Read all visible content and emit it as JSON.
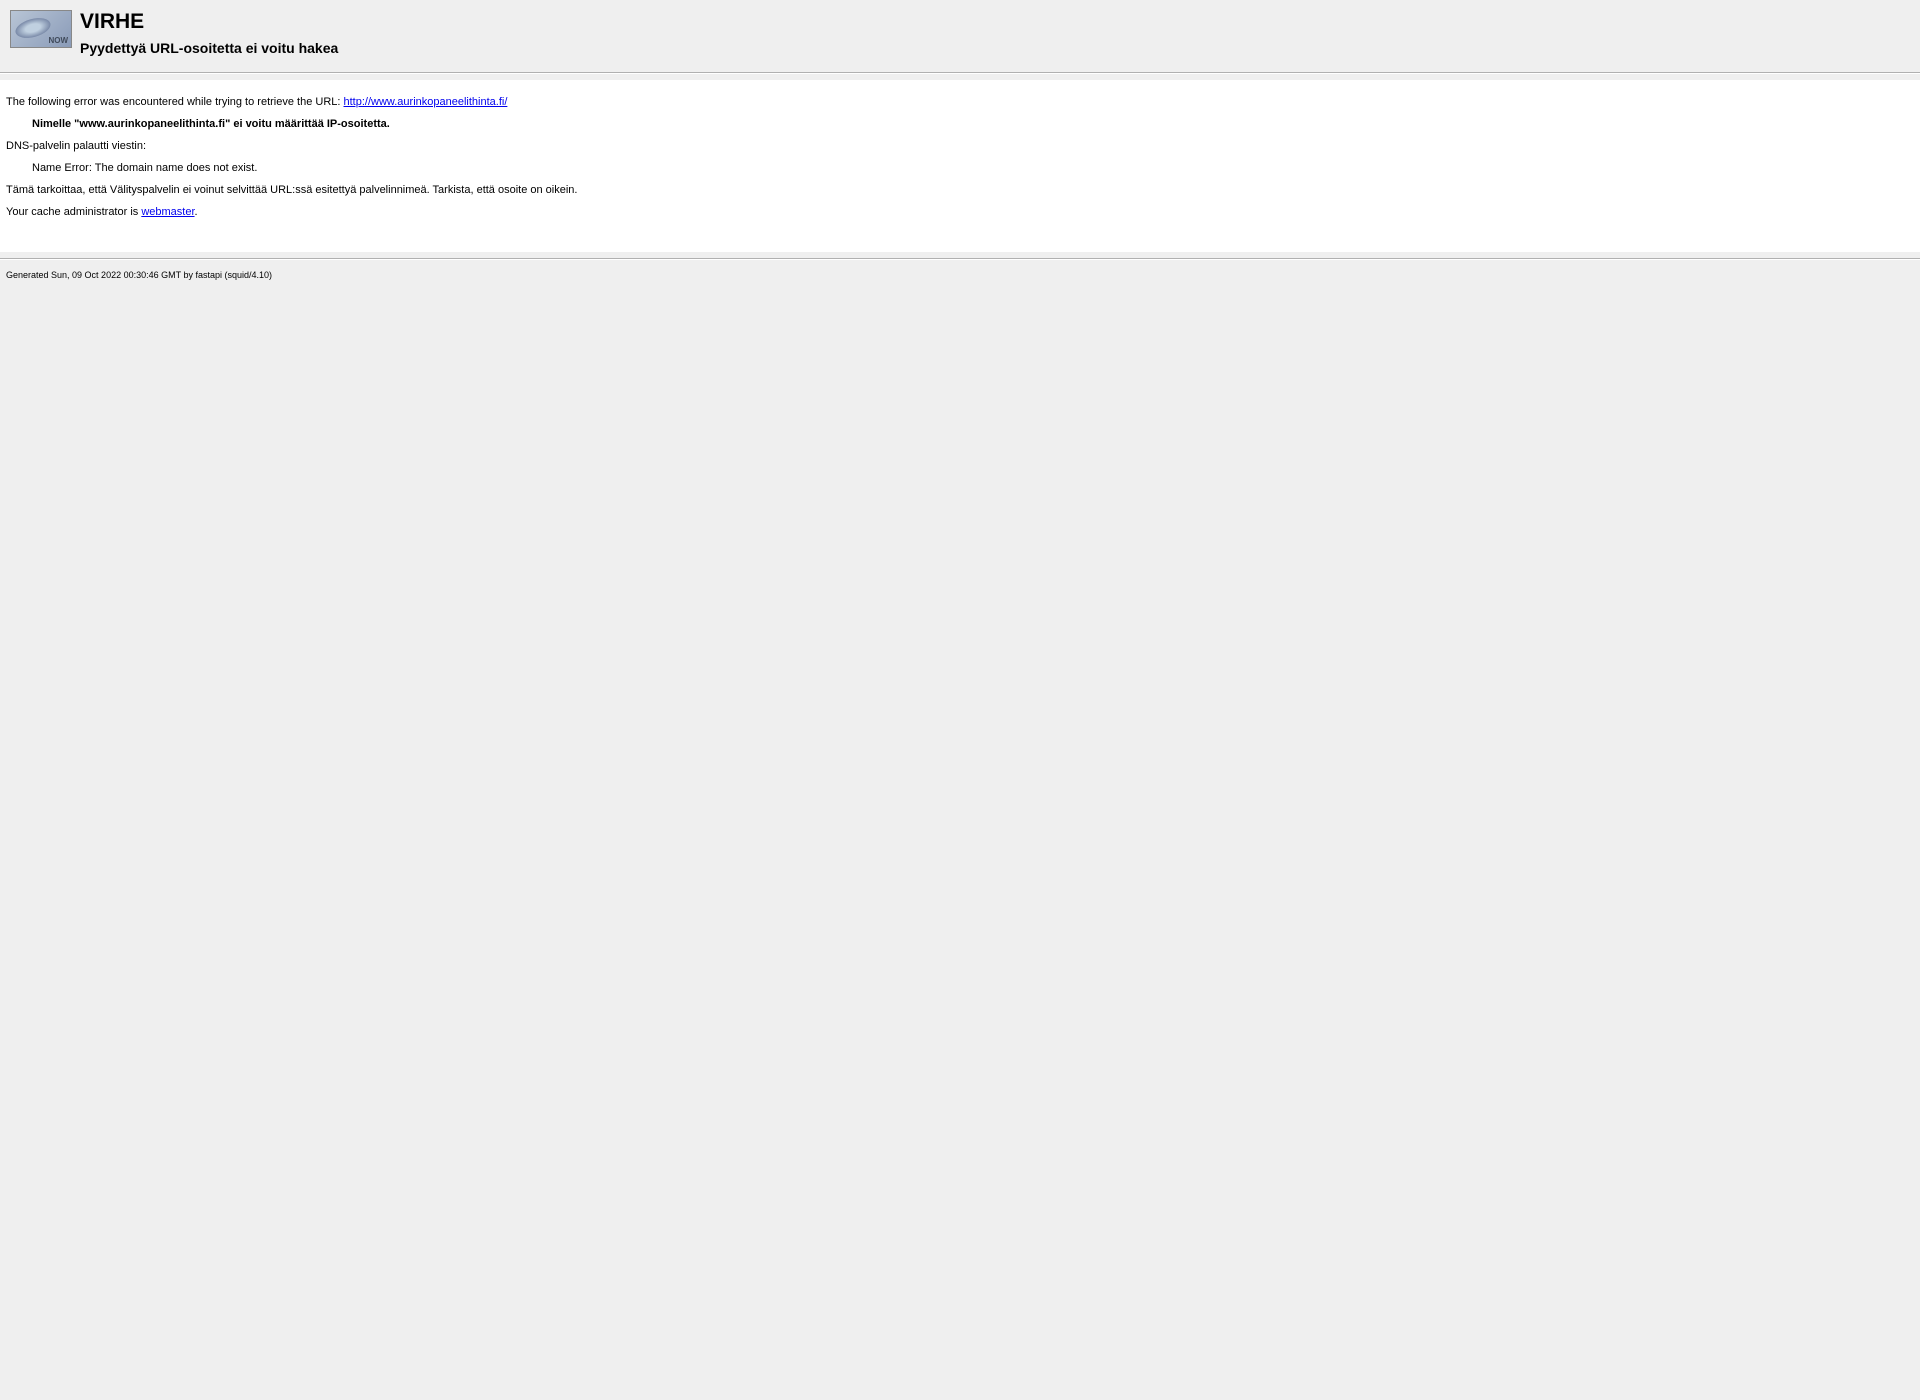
{
  "header": {
    "title": "VIRHE",
    "subtitle": "Pyydettyä URL-osoitetta ei voitu hakea"
  },
  "content": {
    "intro_text": "The following error was encountered while trying to retrieve the URL: ",
    "url": "http://www.aurinkopaneelithinta.fi/",
    "error_message": "Nimelle \"www.aurinkopaneelithinta.fi\" ei voitu määrittää IP-osoitetta.",
    "dns_label": "DNS-palvelin palautti viestin:",
    "dns_message": "Name Error: The domain name does not exist.",
    "explanation": "Tämä tarkoittaa, että Välityspalvelin ei voinut selvittää URL:ssä esitettyä palvelinnimeä. Tarkista, että osoite on oikein.",
    "admin_text": "Your cache administrator is ",
    "admin_link": "webmaster",
    "admin_suffix": "."
  },
  "footer": {
    "text": "Generated Sun, 09 Oct 2022 00:30:46 GMT by fastapi (squid/4.10)"
  }
}
